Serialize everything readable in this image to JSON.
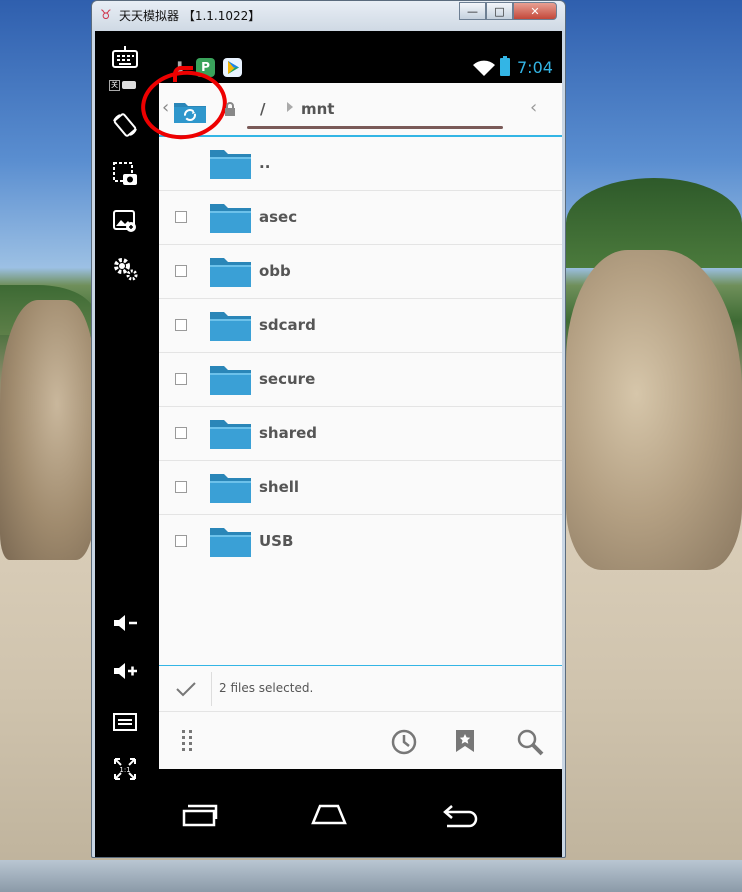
{
  "window": {
    "title": "天天模拟器 【1.1.1022】",
    "min_glyph": "—",
    "max_glyph": "□",
    "close_glyph": "✕"
  },
  "emulator_toolbar": {
    "keyboard_toggle_label": "关",
    "tools": [
      "keyboard-icon",
      "rotate-screen-icon",
      "screenshot-icon",
      "gallery-icon",
      "settings-icon",
      "volume-down-icon",
      "volume-up-icon",
      "menu-icon",
      "fullscreen-icon"
    ]
  },
  "status_bar": {
    "time": "7:04",
    "app_badge": "P",
    "accent": "#33b5e5"
  },
  "path_bar": {
    "root": "/",
    "current": "mnt"
  },
  "files": [
    {
      "name": "..",
      "checkbox": false
    },
    {
      "name": "asec",
      "checkbox": true
    },
    {
      "name": "obb",
      "checkbox": true
    },
    {
      "name": "sdcard",
      "checkbox": true
    },
    {
      "name": "secure",
      "checkbox": true
    },
    {
      "name": "shared",
      "checkbox": true
    },
    {
      "name": "shell",
      "checkbox": true
    },
    {
      "name": "USB",
      "checkbox": true
    }
  ],
  "selection": {
    "text": "2 files selected."
  },
  "bottom_actions": [
    "drag-handle-icon",
    "history-icon",
    "bookmark-icon",
    "search-icon"
  ],
  "nav_buttons": [
    "recent-apps-icon",
    "home-icon",
    "back-icon"
  ]
}
